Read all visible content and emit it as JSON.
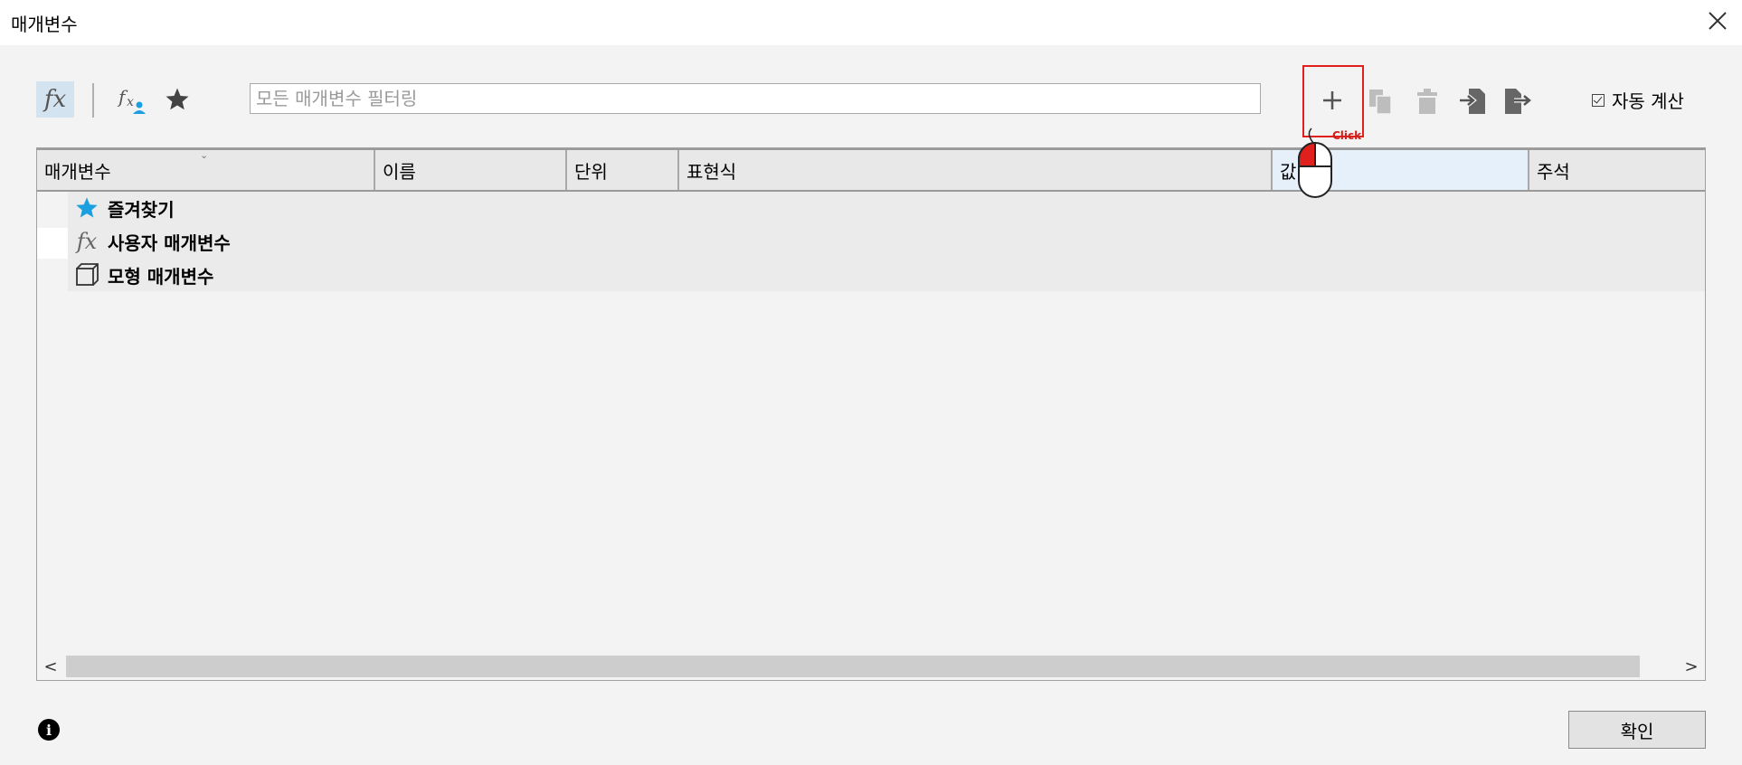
{
  "window": {
    "title": "매개변수",
    "close_label": "Close"
  },
  "toolbar": {
    "filter_placeholder": "모든 매개변수 필터링",
    "auto_calc_label": "자동 계산"
  },
  "grid": {
    "columns": [
      "매개변수",
      "이름",
      "단위",
      "표현식",
      "값",
      "주석"
    ],
    "rows": [
      {
        "label": "즐겨찾기",
        "icon": "star-icon"
      },
      {
        "label": "사용자 매개변수",
        "icon": "fx-icon"
      },
      {
        "label": "모형 매개변수",
        "icon": "cube-icon"
      }
    ],
    "scroll_left": "<",
    "scroll_right": ">"
  },
  "annotation": {
    "click_label": "Click"
  },
  "footer": {
    "ok_label": "확인",
    "info_glyph": "i"
  },
  "colors": {
    "star": "#1a9fe0",
    "highlight": "#e0201c",
    "selected_fx_bg": "#d4e3f0"
  }
}
